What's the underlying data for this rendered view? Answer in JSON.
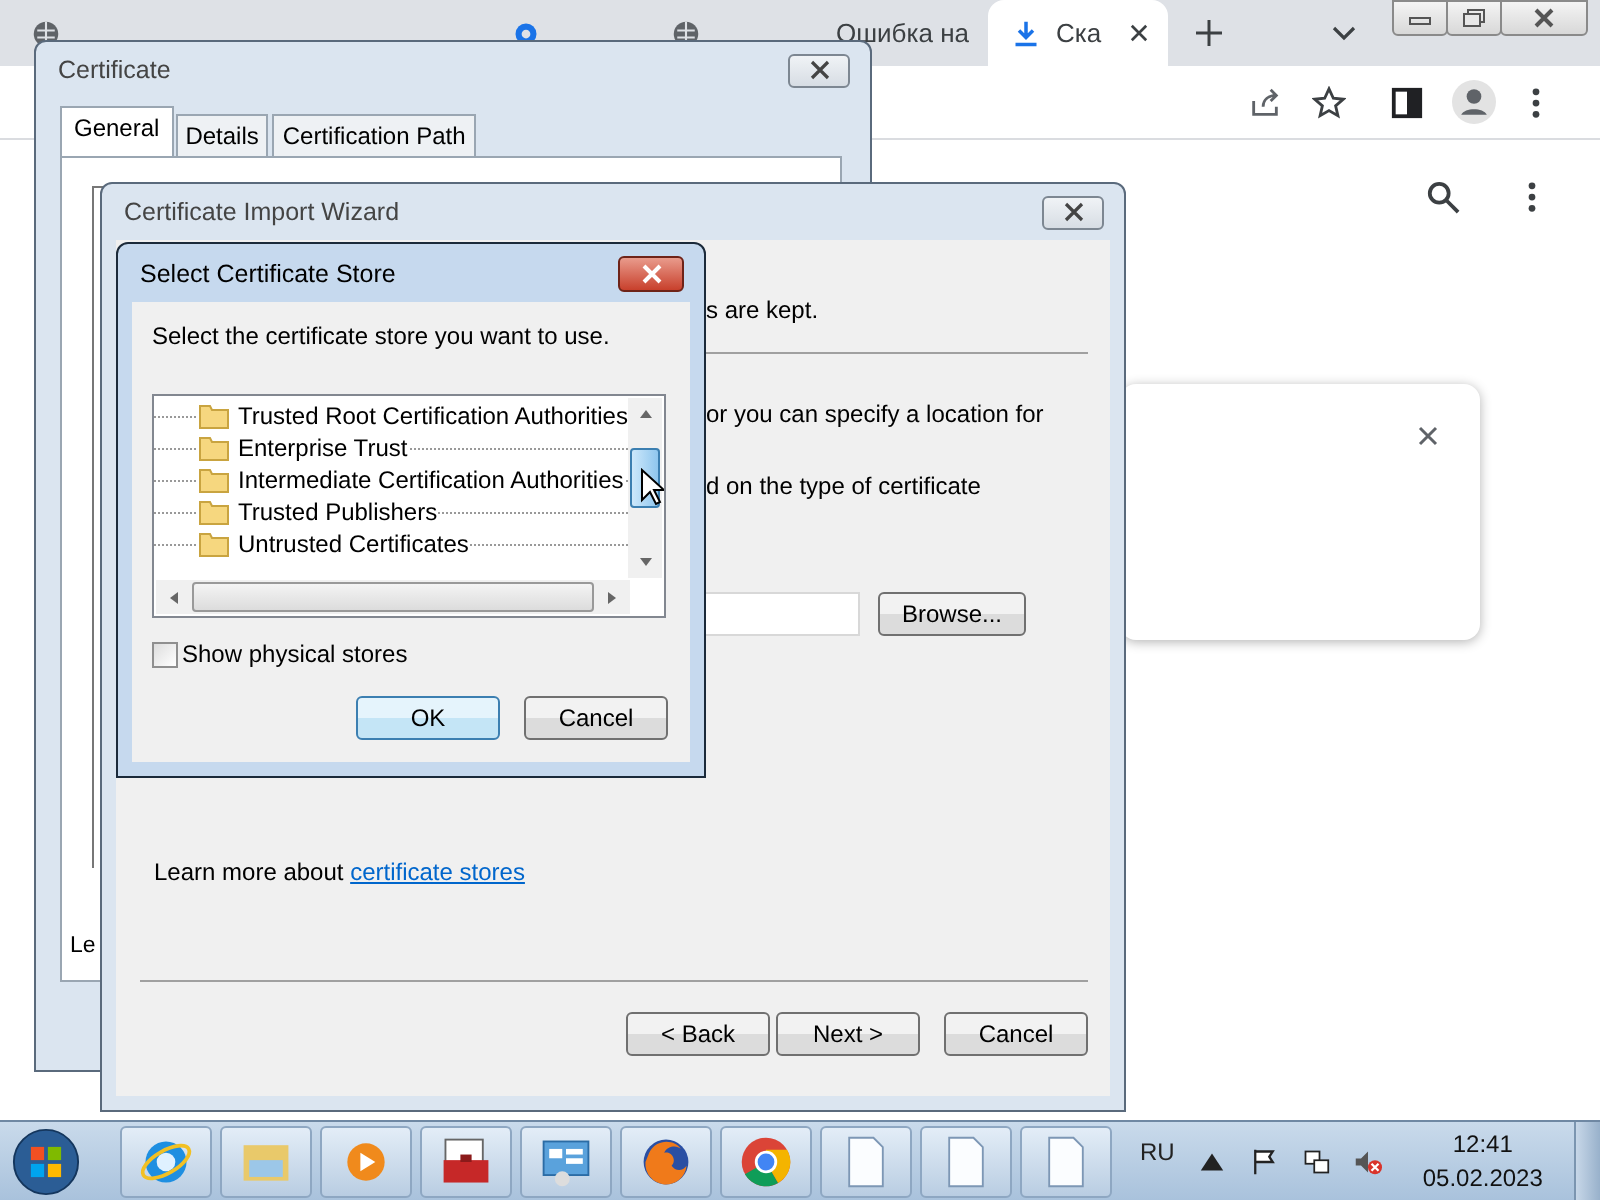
{
  "browser": {
    "tabs": [
      {
        "kind": "globe",
        "selected": false
      },
      {
        "kind": "gear",
        "selected": false
      },
      {
        "kind": "globe",
        "selected": false
      },
      {
        "kind": "blank",
        "title": "Ошибка на",
        "selected": false
      },
      {
        "kind": "download",
        "title": "Ска",
        "selected": true
      }
    ]
  },
  "certificate_window": {
    "title": "Certificate",
    "tabs": [
      {
        "label": "General",
        "selected": true
      },
      {
        "label": "Details",
        "selected": false
      },
      {
        "label": "Certification Path",
        "selected": false
      }
    ],
    "text_fragment": "Le"
  },
  "wizard": {
    "title": "Certificate Import Wizard",
    "fragments": [
      "s are kept.",
      "or you can specify a location for",
      "d on the type of certificate"
    ],
    "browse_button": "Browse...",
    "learn_more": "Learn more about",
    "learn_more_link": "certificate stores",
    "buttons": [
      {
        "label": "< Back"
      },
      {
        "label": "Next >"
      },
      {
        "label": "Cancel"
      }
    ]
  },
  "store_dialog": {
    "title": "Select Certificate Store",
    "prompt": "Select the certificate store you want to use.",
    "stores": [
      {
        "name": "Trusted Root Certification Authorities",
        "selected": false
      },
      {
        "name": "Enterprise Trust",
        "selected": false
      },
      {
        "name": "Intermediate Certification Authorities",
        "selected": false
      },
      {
        "name": "Trusted Publishers",
        "selected": false
      },
      {
        "name": "Untrusted Certificates",
        "selected": false
      }
    ],
    "show_physical_stores": {
      "label": "Show physical stores",
      "checked": false
    },
    "buttons": [
      {
        "label": "OK",
        "default": true
      },
      {
        "label": "Cancel",
        "default": false
      }
    ]
  },
  "taskbar": {
    "apps": [
      {
        "kind": "ie"
      },
      {
        "kind": "explorer"
      },
      {
        "kind": "media"
      },
      {
        "kind": "toolbox"
      },
      {
        "kind": "control-panel"
      },
      {
        "kind": "firefox"
      },
      {
        "kind": "chrome"
      },
      {
        "kind": "document"
      },
      {
        "kind": "document"
      },
      {
        "kind": "document"
      }
    ],
    "language": "RU",
    "time": "12:41",
    "date": "05.02.2023"
  }
}
